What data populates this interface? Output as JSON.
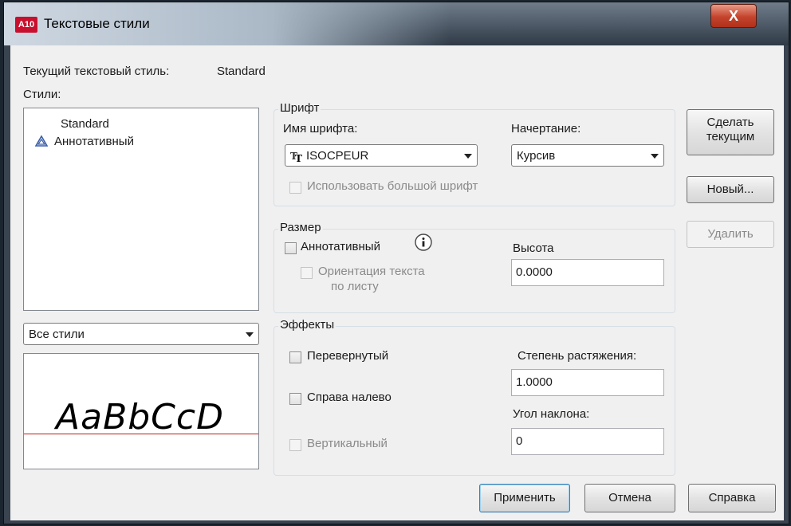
{
  "window": {
    "title": "Текстовые стили",
    "app_icon": "A10",
    "close_label": "X"
  },
  "current_style": {
    "label": "Текущий текстовый стиль:",
    "value": "Standard"
  },
  "styles": {
    "label": "Стили:",
    "items": [
      {
        "name": "Standard",
        "icon": ""
      },
      {
        "name": "Аннотативный",
        "icon": "annotative-icon"
      }
    ],
    "filter": "Все стили"
  },
  "preview_text": "AaBbCcD",
  "font": {
    "group": "Шрифт",
    "name_label": "Имя шрифта:",
    "name_value": "ISOCPEUR",
    "name_icon": "truetype-font-icon",
    "style_label": "Начертание:",
    "style_value": "Курсив",
    "bigfont_label": "Использовать большой шрифт"
  },
  "size": {
    "group": "Размер",
    "annotative_label": "Аннотативный",
    "orientation_label1": "Ориентация текста",
    "orientation_label2": "по листу",
    "height_label": "Высота",
    "height_value": "0.0000"
  },
  "effects": {
    "group": "Эффекты",
    "upside_down_label": "Перевернутый",
    "backwards_label": "Справа налево",
    "vertical_label": "Вертикальный",
    "width_factor_label": "Степень растяжения:",
    "width_factor_value": "1.0000",
    "oblique_label": "Угол наклона:",
    "oblique_value": "0"
  },
  "buttons": {
    "set_current_1": "Сделать",
    "set_current_2": "текущим",
    "new": "Новый...",
    "delete": "Удалить",
    "apply": "Применить",
    "cancel": "Отмена",
    "help": "Справка"
  }
}
